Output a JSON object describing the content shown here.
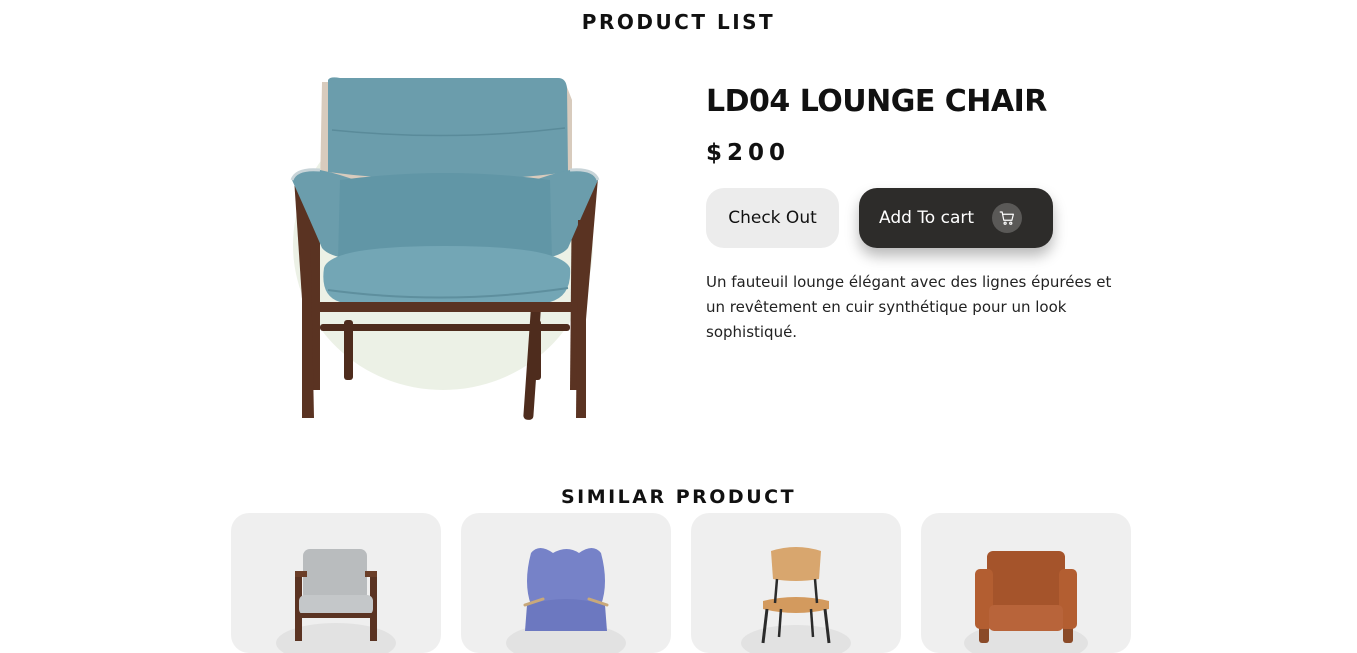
{
  "header": {
    "title": "PRODUCT LIST"
  },
  "product": {
    "name": "LD04 LOUNGE CHAIR",
    "price": "$200",
    "description": "Un fauteuil lounge élégant avec des lignes épurées et un revêtement en cuir synthétique pour un look sophistiqué.",
    "image_icon": "blue-lounge-chair",
    "backdrop_color": "#ecf1e6"
  },
  "actions": {
    "checkout_label": "Check Out",
    "add_to_cart_label": "Add To cart",
    "cart_icon": "cart-icon"
  },
  "similar": {
    "title": "SIMILAR PRODUCT",
    "items": [
      {
        "icon": "grey-armchair"
      },
      {
        "icon": "blue-wingback-chair"
      },
      {
        "icon": "wooden-chair"
      },
      {
        "icon": "leather-armchair"
      }
    ]
  },
  "colors": {
    "primary_button": "#2d2c2a",
    "secondary_button": "#ececec",
    "card_background": "#efefef",
    "chair_fabric": "#6c9fae",
    "chair_wood": "#5a3322"
  }
}
